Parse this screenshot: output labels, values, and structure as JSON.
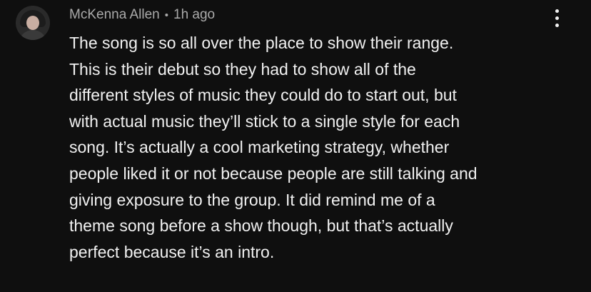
{
  "comment": {
    "author": "McKenna Allen",
    "separator": "•",
    "timestamp": "1h ago",
    "menu_icon": "more-vertical-icon",
    "avatar_icon": "user-avatar",
    "lines": [
      "The song is so all over the place to show their range.",
      "This is their debut so they had to show all of the",
      "different styles of music they could do to start out, but",
      "with actual music they’ll stick to a single style for each",
      "song. It’s actually a cool marketing strategy, whether",
      "people liked it or not because people are still talking and",
      "giving exposure to the group. It did remind me of a",
      "theme song before a show though, but that’s actually",
      "perfect because it’s an intro."
    ]
  },
  "colors": {
    "background": "#0f0f0f",
    "text": "#f1f1f1",
    "meta": "#aaaaaa"
  }
}
